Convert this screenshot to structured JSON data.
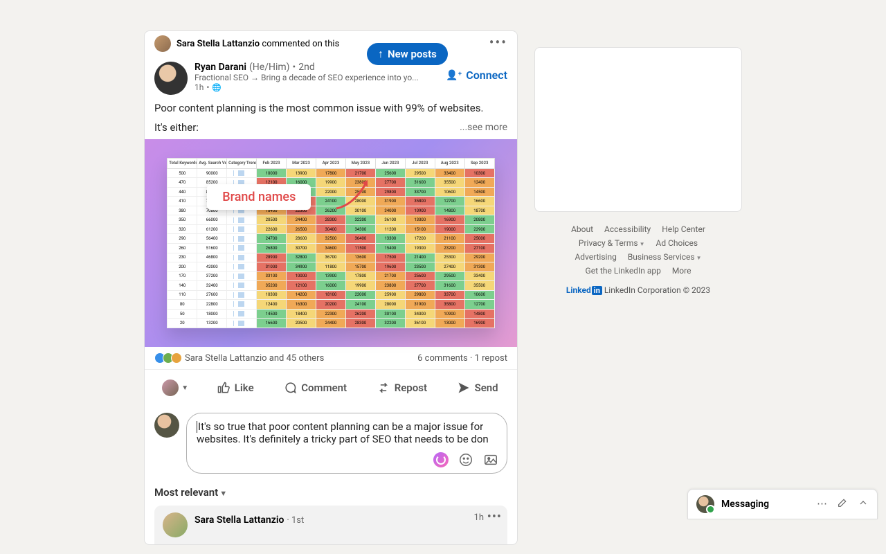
{
  "newPostsPill": "New posts",
  "commentedBy": {
    "name": "Sara Stella Lattanzio",
    "action": "commented on this"
  },
  "post": {
    "author": {
      "name": "Ryan Darani",
      "pronouns": "(He/Him)",
      "degree": "2nd",
      "headline": "Fractional SEO → Bring a decade of SEO experience into yo...",
      "time": "1h",
      "visibility": "public"
    },
    "connectLabel": "Connect",
    "body": {
      "line1": "Poor content planning is the most common issue with 99% of websites.",
      "line2": "It's either:",
      "seeMore": "...see more"
    },
    "image": {
      "annotation": "Brand names",
      "headers": [
        "Total Keywords",
        "Avg. Search Volume",
        "Category Trend",
        "Feb 2023",
        "Mar 2023",
        "Apr 2023",
        "May 2023",
        "Jun 2023",
        "Jul 2023",
        "Aug 2023",
        "Sep 2023"
      ]
    },
    "social": {
      "reactorsText": "Sara Stella Lattanzio and 45 others",
      "commentsText": "6 comments",
      "repostsText": "1 repost"
    },
    "actions": {
      "like": "Like",
      "comment": "Comment",
      "repost": "Repost",
      "send": "Send"
    },
    "commentDraft": "It's so true that poor content planning can be a major issue for websites. It's definitely a tricky part of SEO that needs to be don",
    "sortLabel": "Most relevant",
    "topComment": {
      "name": "Sara Stella Lattanzio",
      "degree": "1st",
      "time": "1h"
    }
  },
  "footer": {
    "links_row1": [
      "About",
      "Accessibility",
      "Help Center"
    ],
    "links_row2": [
      "Privacy & Terms",
      "Ad Choices"
    ],
    "links_row3": [
      "Advertising",
      "Business Services"
    ],
    "links_row4": [
      "Get the LinkedIn app",
      "More"
    ],
    "copyright": "LinkedIn Corporation © 2023"
  },
  "messaging": {
    "label": "Messaging"
  }
}
